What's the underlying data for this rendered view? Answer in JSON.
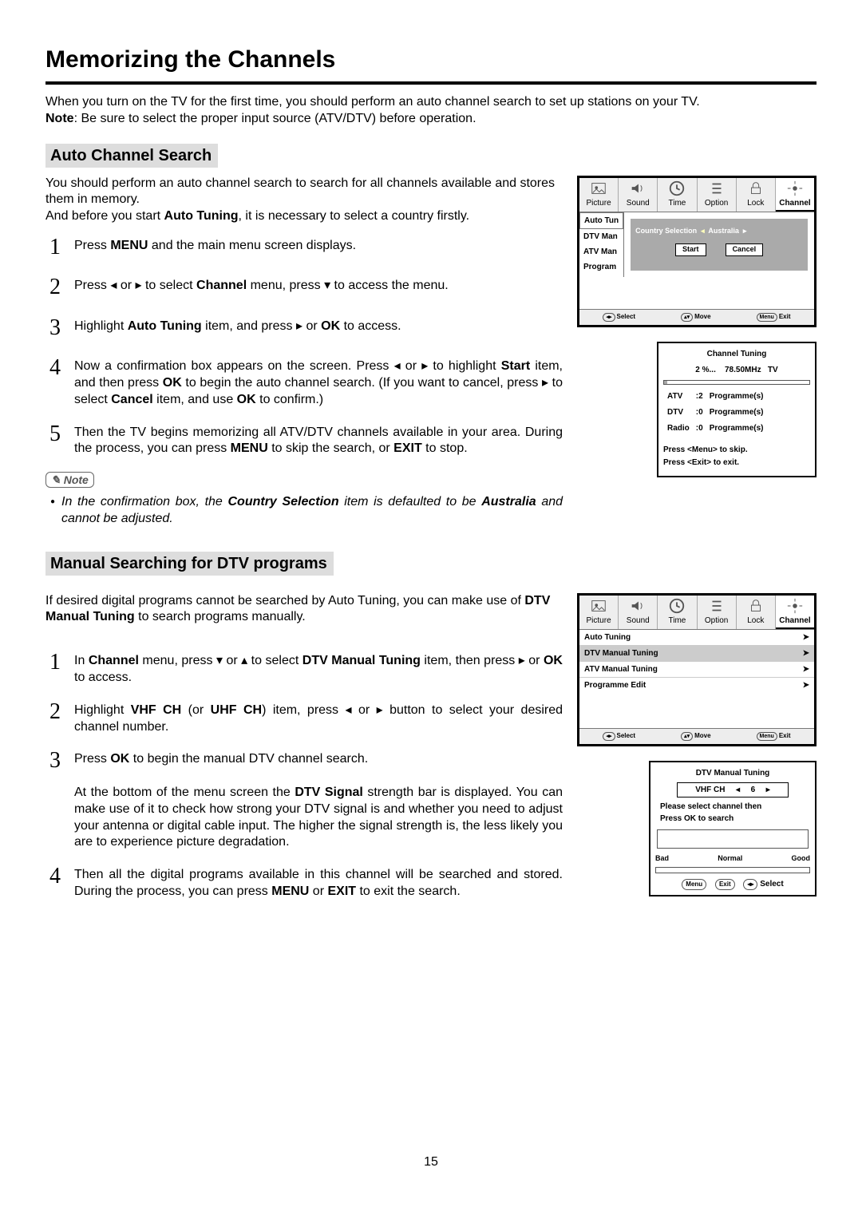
{
  "page_title": "Memorizing the Channels",
  "intro_line1": "When you turn on the TV for the first time, you should perform an auto channel search to set up stations on your TV.",
  "intro_note_label": "Note",
  "intro_note_text": ": Be sure to select the proper input source (ATV/DTV) before operation.",
  "section1": {
    "title": "Auto Channel Search",
    "para1": "You should perform an auto channel search to search for all channels available and stores them in memory.",
    "para2_a": "And before you start ",
    "para2_b": "Auto Tuning",
    "para2_c": ", it is necessary to select a country firstly.",
    "steps": [
      {
        "n": "1",
        "html": "Press <b>MENU</b> and the main menu screen displays."
      },
      {
        "n": "2",
        "html": "Press <span class='arrow'>◂</span> or <span class='arrow'>▸</span> to select <b>Channel</b> menu,  press <span class='arrow'>▾</span> to access the menu."
      },
      {
        "n": "3",
        "html": "Highlight <b>Auto Tuning</b> item, and press <span class='arrow'>▸</span> or <b>OK</b> to access."
      },
      {
        "n": "4",
        "html": "Now a confirmation box appears on the screen. Press <span class='arrow'>◂</span> or <span class='arrow'>▸</span> to highlight <b>Start</b> item, and then press <b>OK</b> to begin the auto channel search. (If you want to cancel, press <span class='arrow'>▸</span> to select <b>Cancel</b> item, and use <b>OK</b> to confirm.)"
      },
      {
        "n": "5",
        "html": "Then the TV begins memorizing all ATV/DTV channels available in your area. During the process, you can press <b>MENU</b> to skip the search, or <b>EXIT</b> to stop."
      }
    ],
    "note_tag": "Note",
    "note_body": "In the confirmation box, the <b>Country Selection</b> item is defaulted to be <b>Australia</b> and cannot be adjusted."
  },
  "section2": {
    "title": "Manual Searching for DTV programs",
    "para_a": "If desired digital programs cannot be searched by Auto Tuning, you can make use of ",
    "para_b": "DTV Manual Tuning",
    "para_c": " to search programs manually.",
    "steps": [
      {
        "n": "1",
        "html": "In <b>Channel</b> menu,  press <span class='arrow'>▾</span> or <span class='arrow'>▴</span>  to select <b>DTV Manual Tuning</b> item, then press <span class='arrow'>▸</span> or <b>OK</b> to access."
      },
      {
        "n": "2",
        "html": "Highlight <b>VHF CH</b> (or <b>UHF CH</b>) item, press <span class='arrow'>◂</span> or <span class='arrow'>▸</span> button to select your desired channel number."
      },
      {
        "n": "3",
        "html": "Press <b>OK</b> to begin the manual DTV channel search.<br><br>At the bottom of the menu screen the <b>DTV Signal</b> strength bar is displayed. You can make use of it to check how strong your DTV signal is and whether you need to adjust your antenna or digital cable input. The higher the signal strength is, the less likely you are to experience picture degradation."
      },
      {
        "n": "4",
        "html": "Then all the digital programs available in this channel will be searched and stored. During the process, you can press <b>MENU</b> or <b>EXIT</b> to exit the search."
      }
    ]
  },
  "osd_tabs": [
    "Picture",
    "Sound",
    "Time",
    "Option",
    "Lock",
    "Channel"
  ],
  "osd1": {
    "side": [
      "Auto Tun",
      "DTV Man",
      "ATV Man",
      "Program"
    ],
    "pop_label": "Country Selection",
    "pop_value": "Australia",
    "btn_start": "Start",
    "btn_cancel": "Cancel",
    "foot": [
      [
        "◂▸",
        "Select"
      ],
      [
        "▴▾",
        "Move"
      ],
      [
        "Menu",
        "Exit"
      ]
    ]
  },
  "tuning": {
    "title": "Channel  Tuning",
    "pct": "2  %...",
    "freq": "78.50MHz",
    "src": "TV",
    "rows": [
      [
        "ATV",
        ":2",
        "Programme(s)"
      ],
      [
        "DTV",
        ":0",
        "Programme(s)"
      ],
      [
        "Radio",
        ":0",
        "Programme(s)"
      ]
    ],
    "hint1": "Press <Menu> to skip.",
    "hint2": "Press <Exit> to exit."
  },
  "osd2": {
    "items": [
      "Auto Tuning",
      "DTV Manual Tuning",
      "ATV Manual Tuning",
      "Programme Edit"
    ],
    "sel_index": 1,
    "foot": [
      [
        "◂▸",
        "Select"
      ],
      [
        "▴▾",
        "Move"
      ],
      [
        "Menu",
        "Exit"
      ]
    ]
  },
  "dtv_box": {
    "title": "DTV Manual Tuning",
    "field": "VHF  CH",
    "value": "6",
    "msg1": "Please select channel then",
    "msg2": "Press OK to search",
    "labels": [
      "Bad",
      "Normal",
      "Good"
    ],
    "foot": [
      [
        "Menu",
        ""
      ],
      [
        "Exit",
        ""
      ],
      [
        "◂▸",
        "Select"
      ]
    ]
  },
  "page_number": "15"
}
